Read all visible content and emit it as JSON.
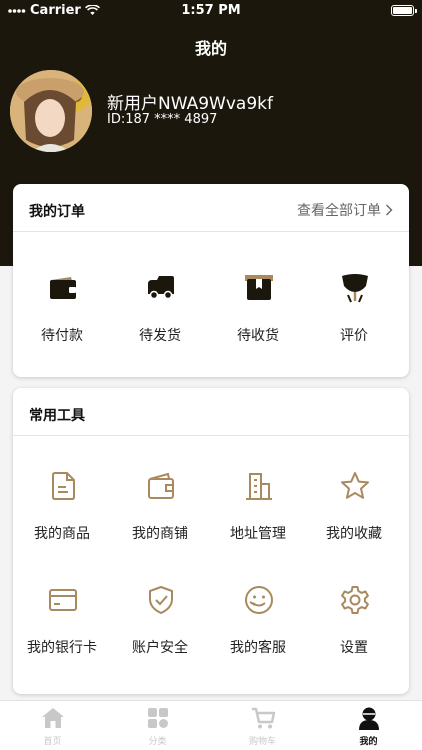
{
  "status": {
    "carrier": "Carrier",
    "time": "1:57 PM"
  },
  "header": {
    "title": "我的"
  },
  "user": {
    "name": "新用户NWA9Wva9kf",
    "id": "ID:187 **** 4897"
  },
  "orders": {
    "title": "我的订单",
    "view_all": "查看全部订单",
    "items": [
      {
        "label": "待付款",
        "icon": "wallet-icon"
      },
      {
        "label": "待发货",
        "icon": "truck-icon"
      },
      {
        "label": "待收货",
        "icon": "box-icon"
      },
      {
        "label": "评价",
        "icon": "review-icon"
      }
    ]
  },
  "tools": {
    "title": "常用工具",
    "items": [
      {
        "label": "我的商品",
        "icon": "document-icon"
      },
      {
        "label": "我的商铺",
        "icon": "wallet-icon"
      },
      {
        "label": "地址管理",
        "icon": "building-icon"
      },
      {
        "label": "我的收藏",
        "icon": "star-icon"
      },
      {
        "label": "我的银行卡",
        "icon": "bank-card-icon"
      },
      {
        "label": "账户安全",
        "icon": "shield-icon"
      },
      {
        "label": "我的客服",
        "icon": "customer-service-icon"
      },
      {
        "label": "设置",
        "icon": "gear-icon"
      }
    ]
  },
  "tabbar": {
    "tabs": [
      {
        "label": "首页",
        "icon": "home-icon"
      },
      {
        "label": "分类",
        "icon": "category-icon"
      },
      {
        "label": "购物车",
        "icon": "cart-icon"
      },
      {
        "label": "我的",
        "icon": "profile-icon"
      }
    ],
    "active": "我的"
  },
  "colors": {
    "header_bg": "#1b170d",
    "accent": "#a98a5e",
    "icon_dark": "#1b170d",
    "inactive": "#c8c8c8"
  }
}
